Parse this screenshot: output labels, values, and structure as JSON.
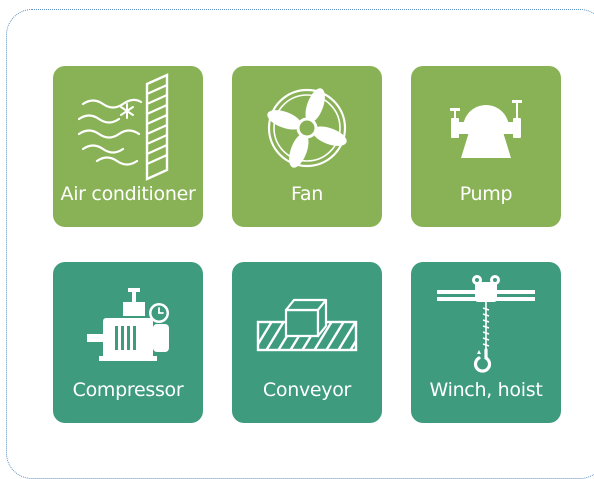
{
  "colors": {
    "green": "#89b256",
    "teal": "#3e9b7e",
    "frame_border": "#5a8fc0"
  },
  "tiles": [
    {
      "label": "Air conditioner",
      "icon": "air-conditioner-icon",
      "color": "#89b256"
    },
    {
      "label": "Fan",
      "icon": "fan-icon",
      "color": "#89b256"
    },
    {
      "label": "Pump",
      "icon": "pump-icon",
      "color": "#89b256"
    },
    {
      "label": "Compressor",
      "icon": "compressor-icon",
      "color": "#3e9b7e"
    },
    {
      "label": "Conveyor",
      "icon": "conveyor-icon",
      "color": "#3e9b7e"
    },
    {
      "label": "Winch, hoist",
      "icon": "winch-hoist-icon",
      "color": "#3e9b7e"
    }
  ]
}
